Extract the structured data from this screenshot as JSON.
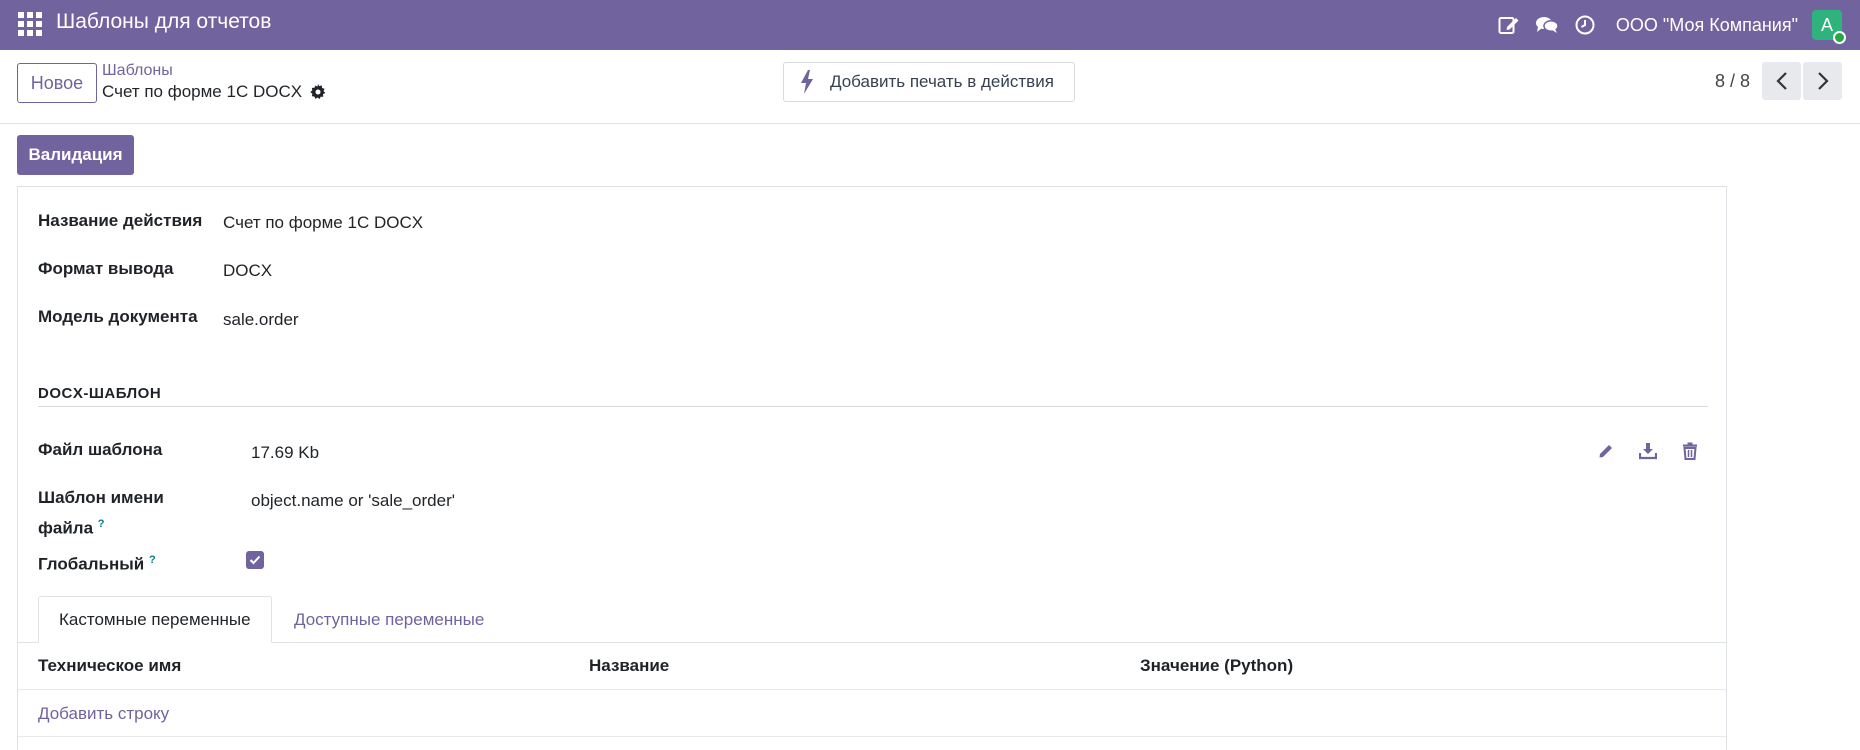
{
  "navbar": {
    "title": "Шаблоны для отчетов",
    "company": "ООО \"Моя Компания\"",
    "avatar_letter": "A",
    "icons": [
      "apps-icon",
      "edit-note-icon",
      "chat-icon",
      "clock-icon"
    ]
  },
  "control": {
    "new_label": "Новое",
    "breadcrumb_parent": "Шаблоны",
    "breadcrumb_current": "Счет по форме 1С DOCX",
    "print_action_label": "Добавить печать в действия",
    "pager": "8 / 8"
  },
  "statusbar": {
    "validate_label": "Валидация"
  },
  "form": {
    "fields": [
      {
        "label": "Название действия",
        "value": "Счет по форме 1С DOCX"
      },
      {
        "label": "Формат вывода",
        "value": "DOCX"
      },
      {
        "label": "Модель документа",
        "value": "sale.order"
      }
    ],
    "section_title": "DOCX-ШАБЛОН",
    "template_file_label": "Файл шаблона",
    "template_file_value": "17.69 Kb",
    "filename_template_label_1": "Шаблон имени",
    "filename_template_label_2": "файла",
    "filename_template_value": "object.name or 'sale_order'",
    "global_label": "Глобальный",
    "global_checked": true,
    "help_mark": "?"
  },
  "tabs": [
    {
      "label": "Кастомные переменные",
      "active": true
    },
    {
      "label": "Доступные переменные",
      "active": false
    }
  ],
  "table": {
    "columns": [
      "Техническое имя",
      "Название",
      "Значение (Python)"
    ],
    "add_line": "Добавить строку"
  },
  "colors": {
    "brand": "#71639e",
    "avatar": "#2db37b"
  }
}
